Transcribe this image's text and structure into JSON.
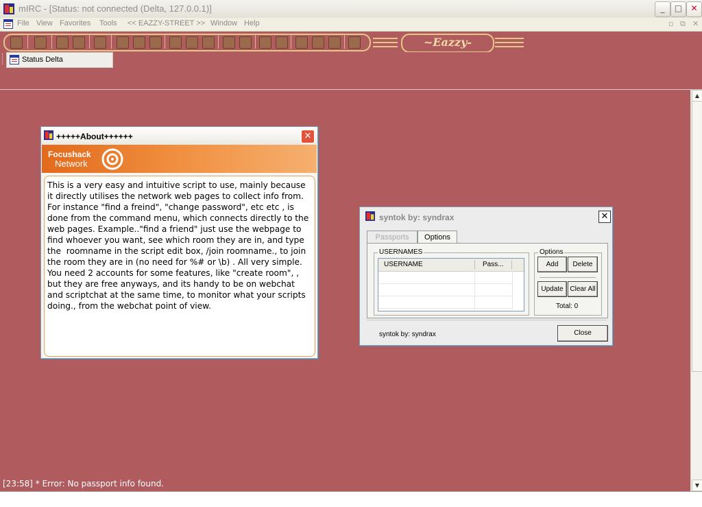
{
  "window": {
    "title": "mIRC - [Status: not connected (Delta, 127.0.0.1)]",
    "min": "_",
    "max": "□",
    "close": "✕"
  },
  "menu": {
    "items": [
      "File",
      "View",
      "Favorites",
      "Tools",
      "<< EAZZY-STREET >>",
      "Window",
      "Help"
    ]
  },
  "toolbar": {
    "brand": "~Eazzy-Street~"
  },
  "switchbar": {
    "tab_label": "Status Delta"
  },
  "status": {
    "error_line": "[23:58] * Error: No passport info found."
  },
  "about": {
    "title": "+++++About++++++",
    "close": "✕",
    "banner_line1": "Focushack",
    "banner_line2": "Network",
    "body": "This is a very easy and intuitive script to use, mainly because it directly utilises the network web pages to collect info from. For instance \"find a freind\", \"change password\", etc etc , is done from the command menu, which connects directly to the web pages. Example..\"find a friend\" just use the webpage to find whoever you want, see which room they are in, and type the  roomname in the script edit box, /join roomname., to join the room they are in (no need for %# or \\b) . All very simple.\nYou need 2 accounts for some features, like \"create room\", , but they are free anyways, and its handy to be on webchat and scriptchat at the same time, to monitor what your scripts doing., from the webchat point of view."
  },
  "syntok": {
    "title": "syntok by: syndrax",
    "close": "✕",
    "tabs": [
      "Passports",
      "Options"
    ],
    "usernames_group": "USERNAMES",
    "columns": [
      "USERNAME",
      "Pass..."
    ],
    "options_group": "Options",
    "buttons": {
      "add": "Add",
      "delete": "Delete",
      "update": "Update",
      "clear_all": "Clear All"
    },
    "total": "Total: 0",
    "footer": "syntok by: syndrax",
    "close_button": "Close"
  },
  "colors": {
    "background": "#b05c5e",
    "accent_gold": "#e6c78a",
    "banner_orange": "#e36a1c"
  }
}
